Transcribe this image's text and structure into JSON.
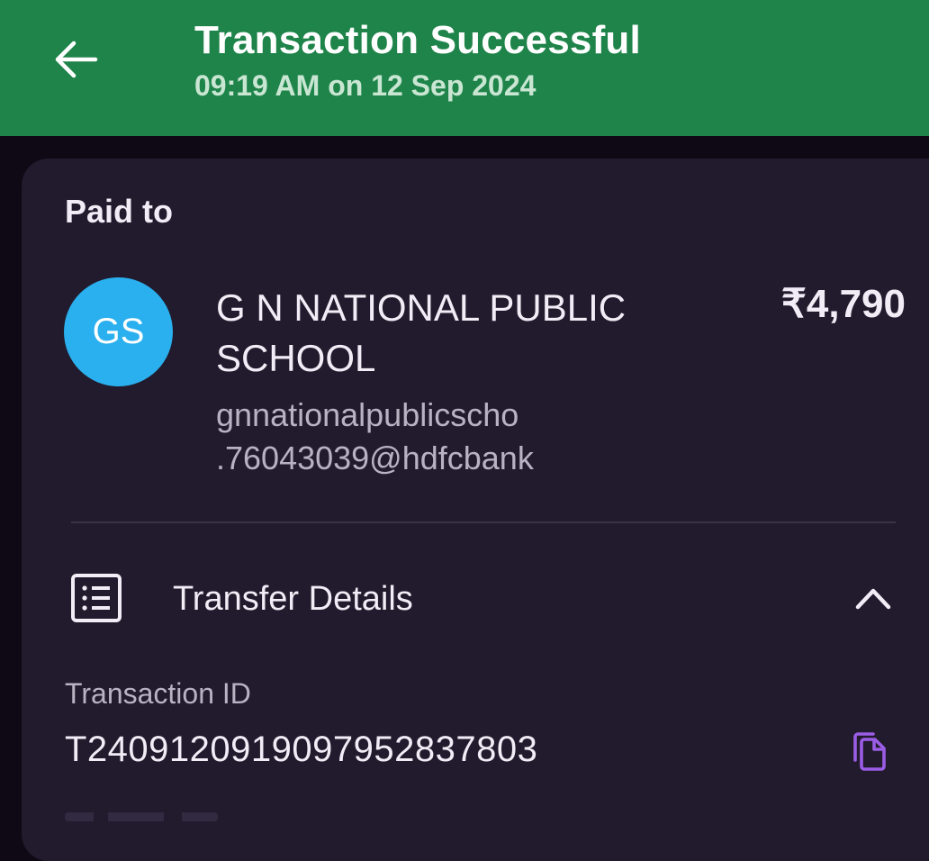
{
  "header": {
    "title": "Transaction Successful",
    "subtitle": "09:19 AM on 12 Sep 2024",
    "back_icon": "arrow-left-icon",
    "background": "#1f844a"
  },
  "payment": {
    "paid_to_label": "Paid to",
    "avatar_initials": "GS",
    "avatar_color": "#2ab0ee",
    "payee_name": "G N NATIONAL PUBLIC SCHOOL",
    "payee_upi": "gnnationalpublicscho.76043039@hdfcbank",
    "amount": "₹4,790"
  },
  "transfer_details": {
    "label": "Transfer Details",
    "icon": "receipt-list-icon",
    "toggle_icon": "chevron-up-icon",
    "expanded": true,
    "transaction_id_label": "Transaction ID",
    "transaction_id": "T2409120919097952837803",
    "copy_icon": "copy-icon",
    "accent": "#9b5de5"
  }
}
